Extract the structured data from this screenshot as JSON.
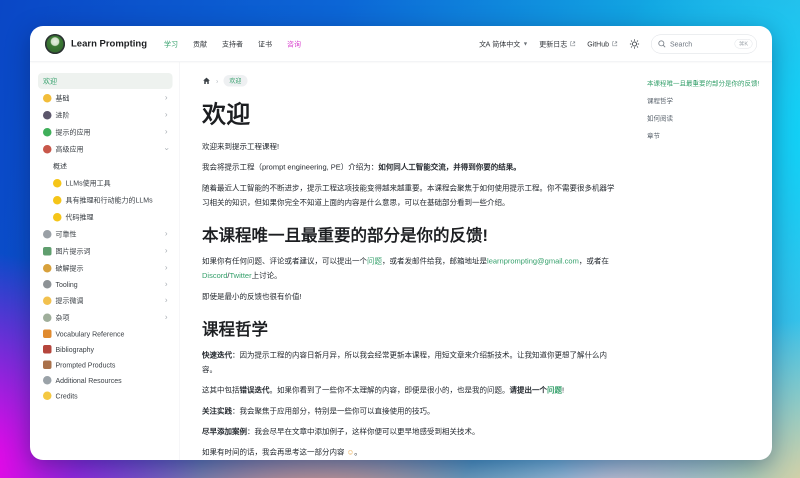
{
  "colors": {
    "accent_green": "#35a06b",
    "nav_highlight_pink": "#d944cf",
    "level_yellow": "#f5c518"
  },
  "navbar": {
    "brand": "Learn Prompting",
    "links": [
      {
        "name": "learn",
        "label": "学习",
        "active": true
      },
      {
        "name": "contribute",
        "label": "贡献"
      },
      {
        "name": "supporters",
        "label": "支持者"
      },
      {
        "name": "certificates",
        "label": "证书"
      },
      {
        "name": "consulting",
        "label": "咨询",
        "highlight": true
      }
    ],
    "locale_label": "简体中文",
    "locale_glyph": "文A",
    "changelog_label": "更新日志",
    "github_label": "GitHub",
    "search": {
      "label": "Search",
      "shortcut": "⌘K"
    }
  },
  "sidebar": {
    "items": [
      {
        "name": "welcome",
        "label": "欢迎",
        "active": true
      },
      {
        "name": "basics",
        "label": "基础",
        "icon": "smiley-icon",
        "icon_color": "#f2bd3a",
        "chevron": "right"
      },
      {
        "name": "intermediate",
        "label": "进阶",
        "icon": "wizard-icon",
        "icon_color": "#5c566b",
        "chevron": "right"
      },
      {
        "name": "applied-prompting",
        "label": "提示的应用",
        "icon": "test-tube-icon",
        "icon_color": "#3faf5a",
        "chevron": "right"
      },
      {
        "name": "advanced-applications",
        "label": "高级应用",
        "icon": "rocket-icon",
        "icon_color": "#c8574a",
        "chevron": "down"
      },
      {
        "name": "overview",
        "label": "概述",
        "sub": true
      },
      {
        "name": "llms-using-tools",
        "label": "LLMs使用工具",
        "icon": "yellow-circle-icon",
        "icon_color": "#f5c518",
        "sub": true
      },
      {
        "name": "llms-reason-act",
        "label": "具有推理和行动能力的LLMs",
        "icon": "yellow-circle-icon",
        "icon_color": "#f5c518",
        "sub": true
      },
      {
        "name": "code-reasoning",
        "label": "代码推理",
        "icon": "yellow-circle-icon",
        "icon_color": "#f5c518",
        "sub": true
      },
      {
        "name": "reliability",
        "label": "可靠性",
        "icon": "scales-icon",
        "icon_color": "#9aa0a6",
        "chevron": "right"
      },
      {
        "name": "image-prompting",
        "label": "图片提示词",
        "icon": "picture-icon",
        "icon_color": "#5f9e6e",
        "icon_shape": "square",
        "chevron": "right"
      },
      {
        "name": "prompt-hacking",
        "label": "破解提示",
        "icon": "lock-icon",
        "icon_color": "#d8a13c",
        "chevron": "right"
      },
      {
        "name": "tooling",
        "label": "Tooling",
        "icon": "hammer-icon",
        "icon_color": "#8d9296",
        "chevron": "right"
      },
      {
        "name": "prompt-tuning",
        "label": "提示微调",
        "icon": "biceps-icon",
        "icon_color": "#f2c14e",
        "chevron": "right"
      },
      {
        "name": "miscellaneous",
        "label": "杂项",
        "icon": "die-icon",
        "icon_color": "#9fae9b",
        "chevron": "right"
      },
      {
        "name": "vocabulary-reference",
        "label": "Vocabulary Reference",
        "icon": "book-icon",
        "icon_color": "#e08a2e",
        "icon_shape": "square"
      },
      {
        "name": "bibliography",
        "label": "Bibliography",
        "icon": "books-icon",
        "icon_color": "#b5453c",
        "icon_shape": "square"
      },
      {
        "name": "prompted-products",
        "label": "Prompted Products",
        "icon": "package-icon",
        "icon_color": "#a9714b",
        "icon_shape": "square"
      },
      {
        "name": "additional-resources",
        "label": "Additional Resources",
        "icon": "ufo-icon",
        "icon_color": "#9aa2a8"
      },
      {
        "name": "credits",
        "label": "Credits",
        "icon": "sparkles-icon",
        "icon_color": "#f4c842"
      }
    ]
  },
  "breadcrumb": {
    "current": "欢迎"
  },
  "article": {
    "title": "欢迎",
    "blocks": [
      {
        "type": "p",
        "segments": [
          {
            "t": "text",
            "text": "欢迎来到提示工程课程!"
          }
        ]
      },
      {
        "type": "p",
        "segments": [
          {
            "t": "text",
            "text": "我会将提示工程（prompt engineering, PE）介绍为："
          },
          {
            "t": "bold",
            "text": "如何同人工智能交流，并得到你要的结果。"
          }
        ]
      },
      {
        "type": "p",
        "segments": [
          {
            "t": "text",
            "text": "随着最近人工智能的不断进步，提示工程这项技能变得越来越重要。本课程会聚焦于如何使用提示工程。你不需要很多机器学习相关的知识，但如果你完全不知道上面的内容是什么意思，可以在基础部分看到一些介绍。"
          }
        ]
      },
      {
        "type": "h2",
        "text": "本课程唯一且最重要的部分是你的反馈!"
      },
      {
        "type": "p",
        "segments": [
          {
            "t": "text",
            "text": "如果你有任何问题、评论或者建议，可以提出一个"
          },
          {
            "t": "link",
            "text": "问题"
          },
          {
            "t": "text",
            "text": "，或者发邮件给我，邮箱地址是"
          },
          {
            "t": "link",
            "text": "learnprompting@gmail.com"
          },
          {
            "t": "text",
            "text": "，或者在"
          },
          {
            "t": "link",
            "text": "Discord"
          },
          {
            "t": "text",
            "text": "/"
          },
          {
            "t": "link",
            "text": "Twitter"
          },
          {
            "t": "text",
            "text": "上讨论。"
          }
        ]
      },
      {
        "type": "p",
        "segments": [
          {
            "t": "text",
            "text": "即使是最小的反馈也很有价值!"
          }
        ]
      },
      {
        "type": "h2",
        "text": "课程哲学"
      },
      {
        "type": "p",
        "segments": [
          {
            "t": "bold",
            "text": "快速迭代"
          },
          {
            "t": "text",
            "text": "：因为提示工程的内容日新月异，所以我会经常更新本课程，用短文章来介绍新技术。让我知道你更想了解什么内容。"
          }
        ]
      },
      {
        "type": "p",
        "segments": [
          {
            "t": "text",
            "text": "这其中包括"
          },
          {
            "t": "bold",
            "text": "错误迭代"
          },
          {
            "t": "text",
            "text": "。如果你看到了一些你不太理解的内容，即便是很小的，也是我的问题。"
          },
          {
            "t": "bold",
            "text": "请提出一个"
          },
          {
            "t": "blink",
            "text": "问题"
          },
          {
            "t": "text",
            "text": "!"
          }
        ]
      },
      {
        "type": "p",
        "segments": [
          {
            "t": "bold",
            "text": "关注实践"
          },
          {
            "t": "text",
            "text": "：我会聚焦于应用部分，特别是一些你可以直接使用的技巧。"
          }
        ]
      },
      {
        "type": "p",
        "segments": [
          {
            "t": "bold",
            "text": "尽早添加案例"
          },
          {
            "t": "text",
            "text": "：我会尽早在文章中添加例子，这样你便可以更早地感受到相关技术。"
          }
        ]
      },
      {
        "type": "p",
        "segments": [
          {
            "t": "text",
            "text": "如果有时间的话，我会再思考这一部分内容 "
          },
          {
            "t": "emoji",
            "text": "☺"
          },
          {
            "t": "text",
            "text": "。"
          }
        ]
      }
    ]
  },
  "toc": {
    "items": [
      {
        "name": "feedback",
        "label": "本课程唯一且最重要的部分是你的反馈!",
        "active": true
      },
      {
        "name": "philosophy",
        "label": "课程哲学"
      },
      {
        "name": "how-to-read",
        "label": "如何阅读"
      },
      {
        "name": "chapters",
        "label": "章节"
      }
    ]
  }
}
